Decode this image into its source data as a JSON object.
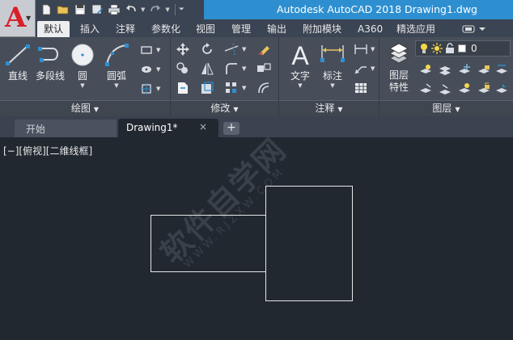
{
  "app": {
    "logo_letter": "A",
    "title": "Autodesk AutoCAD 2018",
    "filename": "Drawing1.dwg"
  },
  "quick_access": [
    "new-icon",
    "open-icon",
    "save-icon",
    "save-as-icon",
    "print-icon",
    "undo-icon",
    "redo-icon"
  ],
  "ribbon_tabs": [
    {
      "label": "默认",
      "active": true
    },
    {
      "label": "插入"
    },
    {
      "label": "注释"
    },
    {
      "label": "参数化"
    },
    {
      "label": "视图"
    },
    {
      "label": "管理"
    },
    {
      "label": "输出"
    },
    {
      "label": "附加模块"
    },
    {
      "label": "A360"
    },
    {
      "label": "精选应用"
    }
  ],
  "panels": {
    "draw": {
      "title": "绘图",
      "tools": {
        "line": "直线",
        "polyline": "多段线",
        "circle": "圆",
        "arc": "圆弧"
      }
    },
    "modify": {
      "title": "修改"
    },
    "annotation": {
      "title": "注释",
      "tools": {
        "text": "文字",
        "dimension": "标注"
      }
    },
    "layers": {
      "title": "图层",
      "tools": {
        "layer_properties": "图层\n特性"
      },
      "current_layer": "0"
    }
  },
  "file_tabs": {
    "start": "开始",
    "drawing": "Drawing1*",
    "close_glyph": "×",
    "new_glyph": "+"
  },
  "viewport": {
    "label": "[−][俯视][二维线框]"
  },
  "watermark": {
    "text": "软件自学网",
    "sub": "WWW.RJZXW.COM"
  },
  "colors": {
    "title_blue": "#2e8fd0",
    "ribbon_bg": "#474e5a",
    "canvas_bg": "#212830",
    "logo_red": "#d8202a",
    "line_color": "#e6e6e6"
  }
}
